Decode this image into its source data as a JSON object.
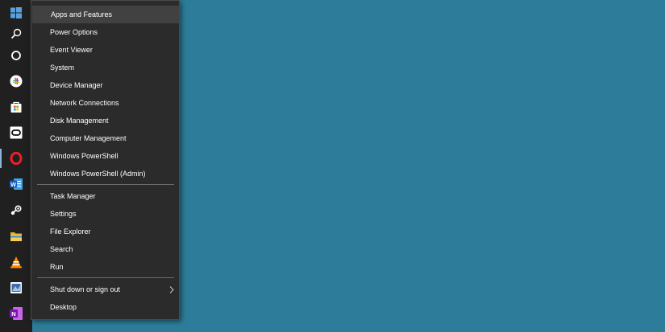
{
  "desktop": {
    "background": "#2d7d9a"
  },
  "taskbar": {
    "items": [
      {
        "name": "windows-start-icon"
      },
      {
        "name": "search-icon"
      },
      {
        "name": "cortana-icon"
      },
      {
        "name": "slack-icon"
      },
      {
        "name": "microsoft-store-icon"
      },
      {
        "name": "oculus-icon"
      },
      {
        "name": "opera-icon"
      },
      {
        "name": "word-icon"
      },
      {
        "name": "steam-icon"
      },
      {
        "name": "file-explorer-icon"
      },
      {
        "name": "vlc-icon"
      },
      {
        "name": "app-icon"
      },
      {
        "name": "onenote-icon"
      }
    ]
  },
  "menu": {
    "items": [
      {
        "label": "Apps and Features"
      },
      {
        "label": "Power Options"
      },
      {
        "label": "Event Viewer"
      },
      {
        "label": "System"
      },
      {
        "label": "Device Manager"
      },
      {
        "label": "Network Connections"
      },
      {
        "label": "Disk Management"
      },
      {
        "label": "Computer Management"
      },
      {
        "label": "Windows PowerShell"
      },
      {
        "label": "Windows PowerShell (Admin)"
      },
      {
        "label": "Task Manager"
      },
      {
        "label": "Settings"
      },
      {
        "label": "File Explorer"
      },
      {
        "label": "Search"
      },
      {
        "label": "Run"
      },
      {
        "label": "Shut down or sign out"
      },
      {
        "label": "Desktop"
      }
    ],
    "highlighted": "Apps and Features",
    "submenu_icon": "chevron-right-icon"
  }
}
